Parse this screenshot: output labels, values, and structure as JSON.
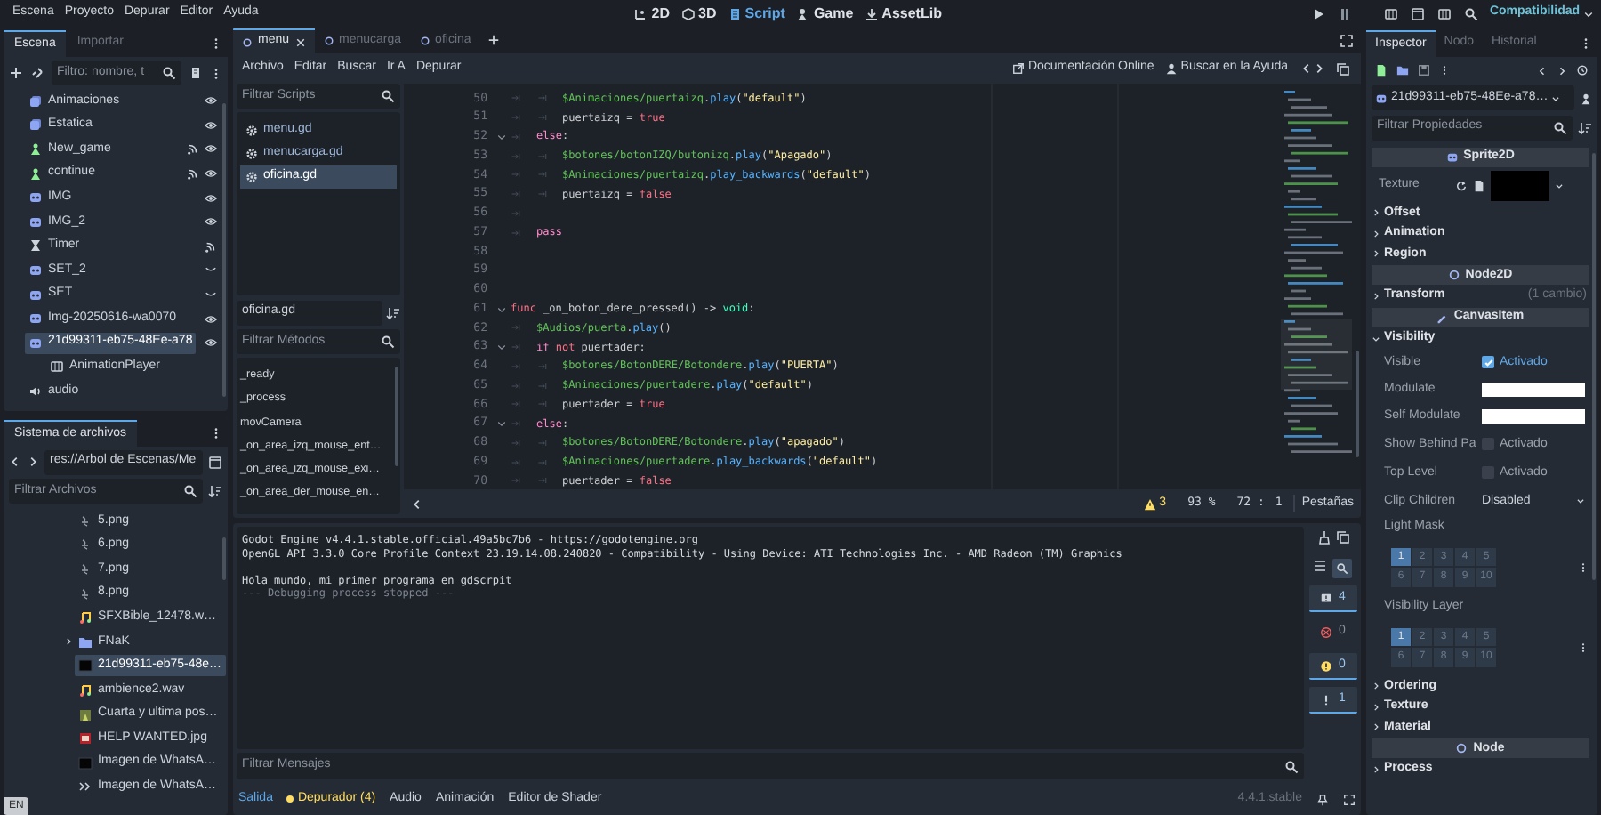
{
  "menu_bar": {
    "menus": [
      "Escena",
      "Proyecto",
      "Depurar",
      "Editor",
      "Ayuda"
    ],
    "workspaces": [
      {
        "label": "2D",
        "kind": "flat",
        "selected": false
      },
      {
        "label": "3D",
        "kind": "spatial",
        "selected": false
      },
      {
        "label": "Script",
        "kind": "script",
        "selected": true
      },
      {
        "label": "Game",
        "kind": "game",
        "selected": false
      },
      {
        "label": "AssetLib",
        "kind": "assetlib",
        "selected": false
      }
    ],
    "renderer": "Compatibilidad"
  },
  "scene_dock": {
    "tabs": [
      {
        "label": "Escena",
        "selected": true
      },
      {
        "label": "Importar",
        "selected": false
      }
    ],
    "filter": {
      "placeholder": "Filtro: nombre, t"
    },
    "nodes": [
      {
        "name": "Animaciones",
        "kind": "animated",
        "visible": true,
        "signals": false,
        "selected": false
      },
      {
        "name": "Estatica",
        "kind": "animated",
        "visible": true,
        "signals": false,
        "selected": false
      },
      {
        "name": "New_game",
        "kind": "button",
        "visible": true,
        "signals": true,
        "selected": false
      },
      {
        "name": "continue",
        "kind": "button",
        "visible": true,
        "signals": true,
        "selected": false
      },
      {
        "name": "IMG",
        "kind": "sprite",
        "visible": true,
        "signals": false,
        "selected": false
      },
      {
        "name": "IMG_2",
        "kind": "sprite",
        "visible": true,
        "signals": false,
        "selected": false
      },
      {
        "name": "Timer",
        "kind": "timer",
        "signals": true,
        "selected": false
      },
      {
        "name": "SET_2",
        "kind": "sprite",
        "visible": false,
        "signals": false,
        "selected": false
      },
      {
        "name": "SET",
        "kind": "sprite",
        "visible": false,
        "signals": false,
        "selected": false
      },
      {
        "name": "Img-20250616-wa0070",
        "kind": "sprite",
        "visible": true,
        "signals": false,
        "selected": false
      },
      {
        "name": "21d99311-eb75-48Ee-a78",
        "kind": "sprite",
        "visible": true,
        "signals": false,
        "selected": true,
        "children": [
          {
            "name": "AnimationPlayer",
            "kind": "animplayer",
            "signals": false,
            "selected": false
          }
        ]
      },
      {
        "name": "audio",
        "kind": "audio",
        "signals": false,
        "selected": false
      }
    ]
  },
  "filesystem_dock": {
    "tab": "Sistema de archivos",
    "path": "res://Arbol de Escenas/Me",
    "filter": {
      "placeholder": "Filtrar Archivos"
    },
    "files": [
      {
        "name": "5.png",
        "kind": "sketch",
        "selected": false
      },
      {
        "name": "6.png",
        "kind": "sketch",
        "selected": false
      },
      {
        "name": "7.png",
        "kind": "sketch",
        "selected": false
      },
      {
        "name": "8.png",
        "kind": "sketch",
        "selected": false
      },
      {
        "name": "SFXBible_12478.w…",
        "kind": "audio",
        "selected": false
      },
      {
        "name": "FNaK",
        "kind": "folder",
        "selected": false
      },
      {
        "name": "21d99311-eb75-48e…",
        "kind": "dark",
        "selected": true
      },
      {
        "name": "ambience2.wav",
        "kind": "audio",
        "selected": false
      },
      {
        "name": "Cuarta y ultima pos…",
        "kind": "photo",
        "selected": false
      },
      {
        "name": "HELP WANTED.jpg",
        "kind": "poster",
        "selected": false
      },
      {
        "name": "Imagen de WhatsA…",
        "kind": "dark",
        "selected": false
      },
      {
        "name": "Imagen de WhatsA…",
        "kind": "arrows",
        "selected": false
      }
    ]
  },
  "input_indicator": "EN",
  "script_tabs": [
    {
      "label": "menu",
      "selected": true
    },
    {
      "label": "menucarga",
      "selected": false
    },
    {
      "label": "oficina",
      "selected": false
    }
  ],
  "script_menu": [
    "Archivo",
    "Editar",
    "Buscar",
    "Ir A",
    "Depurar"
  ],
  "help_links": [
    {
      "label": "Documentación Online",
      "kind": "docs"
    },
    {
      "label": "Buscar en la Ayuda",
      "kind": "help"
    }
  ],
  "scripts_panel": {
    "filter": {
      "placeholder": "Filtrar Scripts"
    },
    "scripts": [
      {
        "name": "menu.gd",
        "selected": false
      },
      {
        "name": "menucarga.gd",
        "selected": false
      },
      {
        "name": "oficina.gd",
        "selected": true
      }
    ],
    "current": "oficina.gd",
    "methods_filter": {
      "placeholder": "Filtrar Métodos"
    },
    "methods": [
      "_ready",
      "_process",
      "movCamera",
      "_on_area_izq_mouse_ent…",
      "_on_area_izq_mouse_exi…",
      "_on_area_der_mouse_en…"
    ]
  },
  "code": {
    "lines": [
      {
        "number": "50",
        "fold": false,
        "tokens": [
          {
            "kind": "tab"
          },
          {
            "kind": "tab"
          },
          {
            "kind": "node",
            "text": "$Animaciones/puertaizq"
          },
          {
            "kind": "p",
            "text": "."
          },
          {
            "kind": "fn",
            "text": "play"
          },
          {
            "kind": "p",
            "text": "("
          },
          {
            "kind": "str",
            "text": "\"default\""
          },
          {
            "kind": "p",
            "text": ")"
          }
        ]
      },
      {
        "number": "51",
        "fold": false,
        "tokens": [
          {
            "kind": "tab"
          },
          {
            "kind": "tab"
          },
          {
            "kind": "p",
            "text": "puertaizq = "
          },
          {
            "kind": "kw",
            "text": "true"
          }
        ]
      },
      {
        "number": "52",
        "fold": true,
        "tokens": [
          {
            "kind": "tab"
          },
          {
            "kind": "ctrl",
            "text": "else"
          },
          {
            "kind": "p",
            "text": ":"
          }
        ]
      },
      {
        "number": "53",
        "fold": false,
        "tokens": [
          {
            "kind": "tab"
          },
          {
            "kind": "tab"
          },
          {
            "kind": "node",
            "text": "$botones/botonIZQ/butonizq"
          },
          {
            "kind": "p",
            "text": "."
          },
          {
            "kind": "fn",
            "text": "play"
          },
          {
            "kind": "p",
            "text": "("
          },
          {
            "kind": "str",
            "text": "\"Apagado\""
          },
          {
            "kind": "p",
            "text": ")"
          }
        ]
      },
      {
        "number": "54",
        "fold": false,
        "tokens": [
          {
            "kind": "tab"
          },
          {
            "kind": "tab"
          },
          {
            "kind": "node",
            "text": "$Animaciones/puertaizq"
          },
          {
            "kind": "p",
            "text": "."
          },
          {
            "kind": "fn",
            "text": "play_backwards"
          },
          {
            "kind": "p",
            "text": "("
          },
          {
            "kind": "str",
            "text": "\"default\""
          },
          {
            "kind": "p",
            "text": ")"
          }
        ]
      },
      {
        "number": "55",
        "fold": false,
        "tokens": [
          {
            "kind": "tab"
          },
          {
            "kind": "tab"
          },
          {
            "kind": "p",
            "text": "puertaizq = "
          },
          {
            "kind": "kw",
            "text": "false"
          }
        ]
      },
      {
        "number": "56",
        "fold": false,
        "tokens": [
          {
            "kind": "tab"
          }
        ]
      },
      {
        "number": "57",
        "fold": false,
        "tokens": [
          {
            "kind": "tab"
          },
          {
            "kind": "ctrl",
            "text": "pass"
          }
        ]
      },
      {
        "number": "58",
        "fold": false
      },
      {
        "number": "59",
        "fold": false
      },
      {
        "number": "60",
        "fold": false
      },
      {
        "number": "61",
        "fold": true,
        "tokens": [
          {
            "kind": "kw",
            "text": "func"
          },
          {
            "kind": "p",
            "text": " _on_boton_dere_pressed() -> "
          },
          {
            "kind": "type",
            "text": "void"
          },
          {
            "kind": "p",
            "text": ":"
          }
        ]
      },
      {
        "number": "62",
        "fold": false,
        "tokens": [
          {
            "kind": "tab"
          },
          {
            "kind": "node",
            "text": "$Audios/puerta"
          },
          {
            "kind": "p",
            "text": "."
          },
          {
            "kind": "fn",
            "text": "play"
          },
          {
            "kind": "p",
            "text": "()"
          }
        ]
      },
      {
        "number": "63",
        "fold": true,
        "tokens": [
          {
            "kind": "tab"
          },
          {
            "kind": "ctrl",
            "text": "if"
          },
          {
            "kind": "kw",
            "text": " not"
          },
          {
            "kind": "p",
            "text": " puertader:"
          }
        ]
      },
      {
        "number": "64",
        "fold": false,
        "tokens": [
          {
            "kind": "tab"
          },
          {
            "kind": "tab"
          },
          {
            "kind": "node",
            "text": "$botones/BotonDERE/Botondere"
          },
          {
            "kind": "p",
            "text": "."
          },
          {
            "kind": "fn",
            "text": "play"
          },
          {
            "kind": "p",
            "text": "("
          },
          {
            "kind": "str",
            "text": "\"PUERTA\""
          },
          {
            "kind": "p",
            "text": ")"
          }
        ]
      },
      {
        "number": "65",
        "fold": false,
        "tokens": [
          {
            "kind": "tab"
          },
          {
            "kind": "tab"
          },
          {
            "kind": "node",
            "text": "$Animaciones/puertadere"
          },
          {
            "kind": "p",
            "text": "."
          },
          {
            "kind": "fn",
            "text": "play"
          },
          {
            "kind": "p",
            "text": "("
          },
          {
            "kind": "str",
            "text": "\"default\""
          },
          {
            "kind": "p",
            "text": ")"
          }
        ]
      },
      {
        "number": "66",
        "fold": false,
        "tokens": [
          {
            "kind": "tab"
          },
          {
            "kind": "tab"
          },
          {
            "kind": "p",
            "text": "puertader = "
          },
          {
            "kind": "kw",
            "text": "true"
          }
        ]
      },
      {
        "number": "67",
        "fold": true,
        "tokens": [
          {
            "kind": "tab"
          },
          {
            "kind": "ctrl",
            "text": "else"
          },
          {
            "kind": "p",
            "text": ":"
          }
        ]
      },
      {
        "number": "68",
        "fold": false,
        "tokens": [
          {
            "kind": "tab"
          },
          {
            "kind": "tab"
          },
          {
            "kind": "node",
            "text": "$botones/BotonDERE/Botondere"
          },
          {
            "kind": "p",
            "text": "."
          },
          {
            "kind": "fn",
            "text": "play"
          },
          {
            "kind": "p",
            "text": "("
          },
          {
            "kind": "str",
            "text": "\"apagado\""
          },
          {
            "kind": "p",
            "text": ")"
          }
        ]
      },
      {
        "number": "69",
        "fold": false,
        "tokens": [
          {
            "kind": "tab"
          },
          {
            "kind": "tab"
          },
          {
            "kind": "node",
            "text": "$Animaciones/puertadere"
          },
          {
            "kind": "p",
            "text": "."
          },
          {
            "kind": "fn",
            "text": "play_backwards"
          },
          {
            "kind": "p",
            "text": "("
          },
          {
            "kind": "str",
            "text": "\"default\""
          },
          {
            "kind": "p",
            "text": ")"
          }
        ]
      },
      {
        "number": "70",
        "fold": false,
        "tokens": [
          {
            "kind": "tab"
          },
          {
            "kind": "tab"
          },
          {
            "kind": "p",
            "text": "puertader = "
          },
          {
            "kind": "kw",
            "text": "false"
          }
        ]
      }
    ]
  },
  "code_status": {
    "warnings": "3",
    "zoom": "93 %",
    "line": "72 :",
    "column": "1",
    "indent_mode": "Pestañas"
  },
  "output": {
    "lines": [
      {
        "text": "Godot Engine v4.4.1.stable.official.49a5bc7b6 - https://godotengine.org",
        "kind": "normal"
      },
      {
        "text": "OpenGL API 3.3.0 Core Profile Context 23.19.14.08.240820 - Compatibility - Using Device: ATI Technologies Inc. - AMD Radeon (TM) Graphics",
        "kind": "normal"
      },
      {
        "text": "Hola mundo, mi primer programa en gdscrpit",
        "kind": "normal"
      },
      {
        "text": "--- Debugging process stopped ---",
        "kind": "dim"
      }
    ],
    "filter": {
      "placeholder": "Filtrar Mensajes"
    },
    "counters": [
      {
        "kind": "messages",
        "count": "4",
        "on": true
      },
      {
        "kind": "errors",
        "count": "0",
        "on": false
      },
      {
        "kind": "warnings",
        "count": "0",
        "on": true
      },
      {
        "kind": "editor",
        "count": "1",
        "on": true
      }
    ]
  },
  "bottom_tabs": [
    {
      "label": "Salida",
      "kind": "plain",
      "selected": true
    },
    {
      "label": "Depurador (4)",
      "kind": "alert",
      "selected": false
    },
    {
      "label": "Audio",
      "kind": "plain",
      "selected": false
    },
    {
      "label": "Animación",
      "kind": "plain",
      "selected": false
    },
    {
      "label": "Editor de Shader",
      "kind": "plain",
      "selected": false
    }
  ],
  "version": "4.4.1.stable",
  "inspector": {
    "tabs": [
      {
        "label": "Inspector",
        "selected": true
      },
      {
        "label": "Nodo",
        "selected": false
      },
      {
        "label": "Historial",
        "selected": false
      }
    ],
    "object": "21d99311-eb75-48Ee-a78…",
    "filter": {
      "placeholder": "Filtrar Propiedades"
    },
    "rows": [
      {
        "kind": "category",
        "label": "Sprite2D"
      },
      {
        "kind": "texture",
        "label": "Texture"
      },
      {
        "kind": "group",
        "label": "Offset",
        "expanded": false
      },
      {
        "kind": "group",
        "label": "Animation",
        "expanded": false
      },
      {
        "kind": "group",
        "label": "Region",
        "expanded": false
      },
      {
        "kind": "category",
        "label": "Node2D"
      },
      {
        "kind": "group",
        "label": "Transform",
        "expanded": false,
        "note": "(1 cambio)"
      },
      {
        "kind": "category",
        "label": "CanvasItem"
      },
      {
        "kind": "group",
        "label": "Visibility",
        "expanded": true
      },
      {
        "kind": "check",
        "label": "Visible",
        "checked": true,
        "value": "Activado"
      },
      {
        "kind": "color",
        "label": "Modulate",
        "color": "#ffffff"
      },
      {
        "kind": "color",
        "label": "Self Modulate",
        "color": "#ffffff"
      },
      {
        "kind": "check",
        "label": "Show Behind Pa",
        "checked": false,
        "value": "Activado"
      },
      {
        "kind": "check",
        "label": "Top Level",
        "checked": false,
        "value": "Activado"
      },
      {
        "kind": "enum",
        "label": "Clip Children",
        "value": "Disabled"
      },
      {
        "kind": "layers",
        "label": "Light Mask",
        "layers": [
          {
            "label": "1",
            "selected": true
          },
          {
            "label": "2",
            "selected": false
          },
          {
            "label": "3",
            "selected": false
          },
          {
            "label": "4",
            "selected": false
          },
          {
            "label": "5",
            "selected": false
          },
          {
            "label": "6",
            "selected": false
          },
          {
            "label": "7",
            "selected": false
          },
          {
            "label": "8",
            "selected": false
          },
          {
            "label": "9",
            "selected": false
          },
          {
            "label": "10",
            "selected": false
          }
        ]
      },
      {
        "kind": "layers",
        "label": "Visibility Layer",
        "layers": [
          {
            "label": "1",
            "selected": true
          },
          {
            "label": "2",
            "selected": false
          },
          {
            "label": "3",
            "selected": false
          },
          {
            "label": "4",
            "selected": false
          },
          {
            "label": "5",
            "selected": false
          },
          {
            "label": "6",
            "selected": false
          },
          {
            "label": "7",
            "selected": false
          },
          {
            "label": "8",
            "selected": false
          },
          {
            "label": "9",
            "selected": false
          },
          {
            "label": "10",
            "selected": false
          }
        ]
      },
      {
        "kind": "group",
        "label": "Ordering",
        "expanded": false
      },
      {
        "kind": "group",
        "label": "Texture",
        "expanded": false
      },
      {
        "kind": "group",
        "label": "Material",
        "expanded": false
      },
      {
        "kind": "category",
        "label": "Node"
      },
      {
        "kind": "group",
        "label": "Process",
        "expanded": false
      }
    ]
  }
}
